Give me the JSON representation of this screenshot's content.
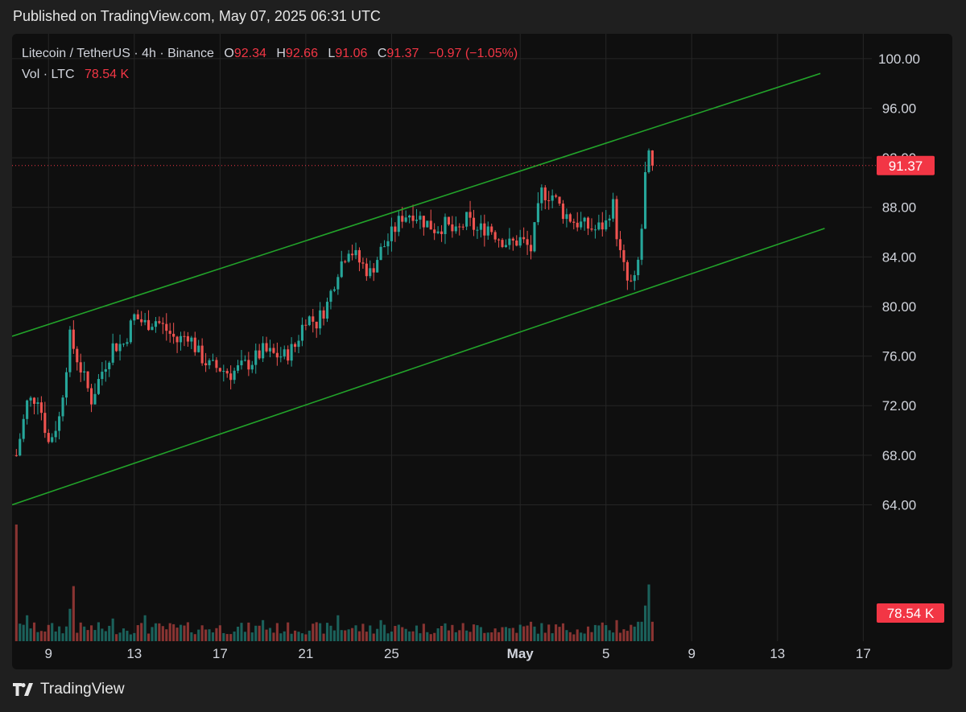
{
  "header": {
    "published": "Published on TradingView.com, May 07, 2025 06:31 UTC"
  },
  "legend": {
    "symbol": "Litecoin / TetherUS · 4h · Binance",
    "o_label": "O",
    "o_value": "92.34",
    "h_label": "H",
    "h_value": "92.66",
    "l_label": "L",
    "l_value": "91.06",
    "c_label": "C",
    "c_value": "91.37",
    "change": "−0.97 (−1.05%)",
    "vol_label": "Vol · LTC",
    "vol_value": "78.54 K"
  },
  "footer": {
    "brand": "TradingView"
  },
  "colors": {
    "up": "#26a69a",
    "down": "#ef5350",
    "channel": "#22a32a",
    "price_line": "#f23645",
    "grid": "#262626",
    "panel_bg": "#0f0f0f"
  },
  "chart_data": {
    "type": "candlestick",
    "symbol": "LTC/USDT",
    "interval": "4h",
    "y_ticks": [
      "64.00",
      "68.00",
      "72.00",
      "76.00",
      "80.00",
      "84.00",
      "88.00",
      "92.00",
      "96.00",
      "100.00"
    ],
    "y_range": [
      53,
      102
    ],
    "x_ticks": [
      {
        "label": "9",
        "day": 9
      },
      {
        "label": "13",
        "day": 13
      },
      {
        "label": "17",
        "day": 17
      },
      {
        "label": "21",
        "day": 21
      },
      {
        "label": "25",
        "day": 25
      },
      {
        "label": "May",
        "day": 31,
        "bold": true
      },
      {
        "label": "5",
        "day": 35
      },
      {
        "label": "9",
        "day": 39
      },
      {
        "label": "13",
        "day": 43
      },
      {
        "label": "17",
        "day": 47
      }
    ],
    "x_day_range": [
      7.3,
      47.4
    ],
    "last_price": "91.37",
    "last_volume": "78.54 K",
    "channel_upper": [
      [
        7.3,
        77.6
      ],
      [
        45.0,
        98.8
      ]
    ],
    "channel_lower": [
      [
        7.3,
        64.0
      ],
      [
        45.2,
        86.3
      ]
    ],
    "daily_closes": [
      [
        7.5,
        68.0
      ],
      [
        8.0,
        72.2
      ],
      [
        8.5,
        72.8
      ],
      [
        9.0,
        69.0
      ],
      [
        9.5,
        71.0
      ],
      [
        10.0,
        77.5
      ],
      [
        10.5,
        75.0
      ],
      [
        11.0,
        72.5
      ],
      [
        11.5,
        74.8
      ],
      [
        12.0,
        76.8
      ],
      [
        12.5,
        77.0
      ],
      [
        13.0,
        79.2
      ],
      [
        13.5,
        78.6
      ],
      [
        14.0,
        78.9
      ],
      [
        14.5,
        78.1
      ],
      [
        15.0,
        77.2
      ],
      [
        15.5,
        77.8
      ],
      [
        16.0,
        76.2
      ],
      [
        16.5,
        75.2
      ],
      [
        17.0,
        75.0
      ],
      [
        17.5,
        74.6
      ],
      [
        18.0,
        75.1
      ],
      [
        18.5,
        75.6
      ],
      [
        19.0,
        76.4
      ],
      [
        19.5,
        76.1
      ],
      [
        20.0,
        76.0
      ],
      [
        20.5,
        76.8
      ],
      [
        21.0,
        79.2
      ],
      [
        21.5,
        78.7
      ],
      [
        22.0,
        80.2
      ],
      [
        22.5,
        83.0
      ],
      [
        23.0,
        84.8
      ],
      [
        23.5,
        83.6
      ],
      [
        24.0,
        82.7
      ],
      [
        24.5,
        84.5
      ],
      [
        25.0,
        85.8
      ],
      [
        25.5,
        87.3
      ],
      [
        26.0,
        87.6
      ],
      [
        26.5,
        86.9
      ],
      [
        27.0,
        86.3
      ],
      [
        27.5,
        86.6
      ],
      [
        28.0,
        85.8
      ],
      [
        28.5,
        87.0
      ],
      [
        29.0,
        86.1
      ],
      [
        29.5,
        86.5
      ],
      [
        30.0,
        85.6
      ],
      [
        30.5,
        85.0
      ],
      [
        31.0,
        85.4
      ],
      [
        31.5,
        84.6
      ],
      [
        32.0,
        89.2
      ],
      [
        32.5,
        89.0
      ],
      [
        33.0,
        87.6
      ],
      [
        33.5,
        86.9
      ],
      [
        34.0,
        86.5
      ],
      [
        34.5,
        86.2
      ],
      [
        35.0,
        86.7
      ],
      [
        35.3,
        88.6
      ],
      [
        35.6,
        84.6
      ],
      [
        36.0,
        82.0
      ],
      [
        36.3,
        81.6
      ],
      [
        36.6,
        84.6
      ],
      [
        36.9,
        92.2
      ],
      [
        37.2,
        91.37
      ]
    ],
    "volumes": {
      "baseline": 4200,
      "spikes": [
        [
          7.5,
          36000
        ],
        [
          8.0,
          8000
        ],
        [
          10.0,
          10000
        ],
        [
          10.2,
          17000
        ],
        [
          12.0,
          7000
        ],
        [
          13.5,
          8000
        ],
        [
          19.0,
          6500
        ],
        [
          22.5,
          8000
        ],
        [
          24.5,
          6500
        ],
        [
          27.5,
          5500
        ],
        [
          31.5,
          6000
        ],
        [
          35.5,
          6500
        ],
        [
          36.4,
          4500
        ],
        [
          36.6,
          6000
        ],
        [
          36.9,
          11000
        ],
        [
          37.0,
          18000
        ],
        [
          37.1,
          17500
        ],
        [
          37.2,
          6000
        ]
      ],
      "unit": "LTC"
    }
  }
}
